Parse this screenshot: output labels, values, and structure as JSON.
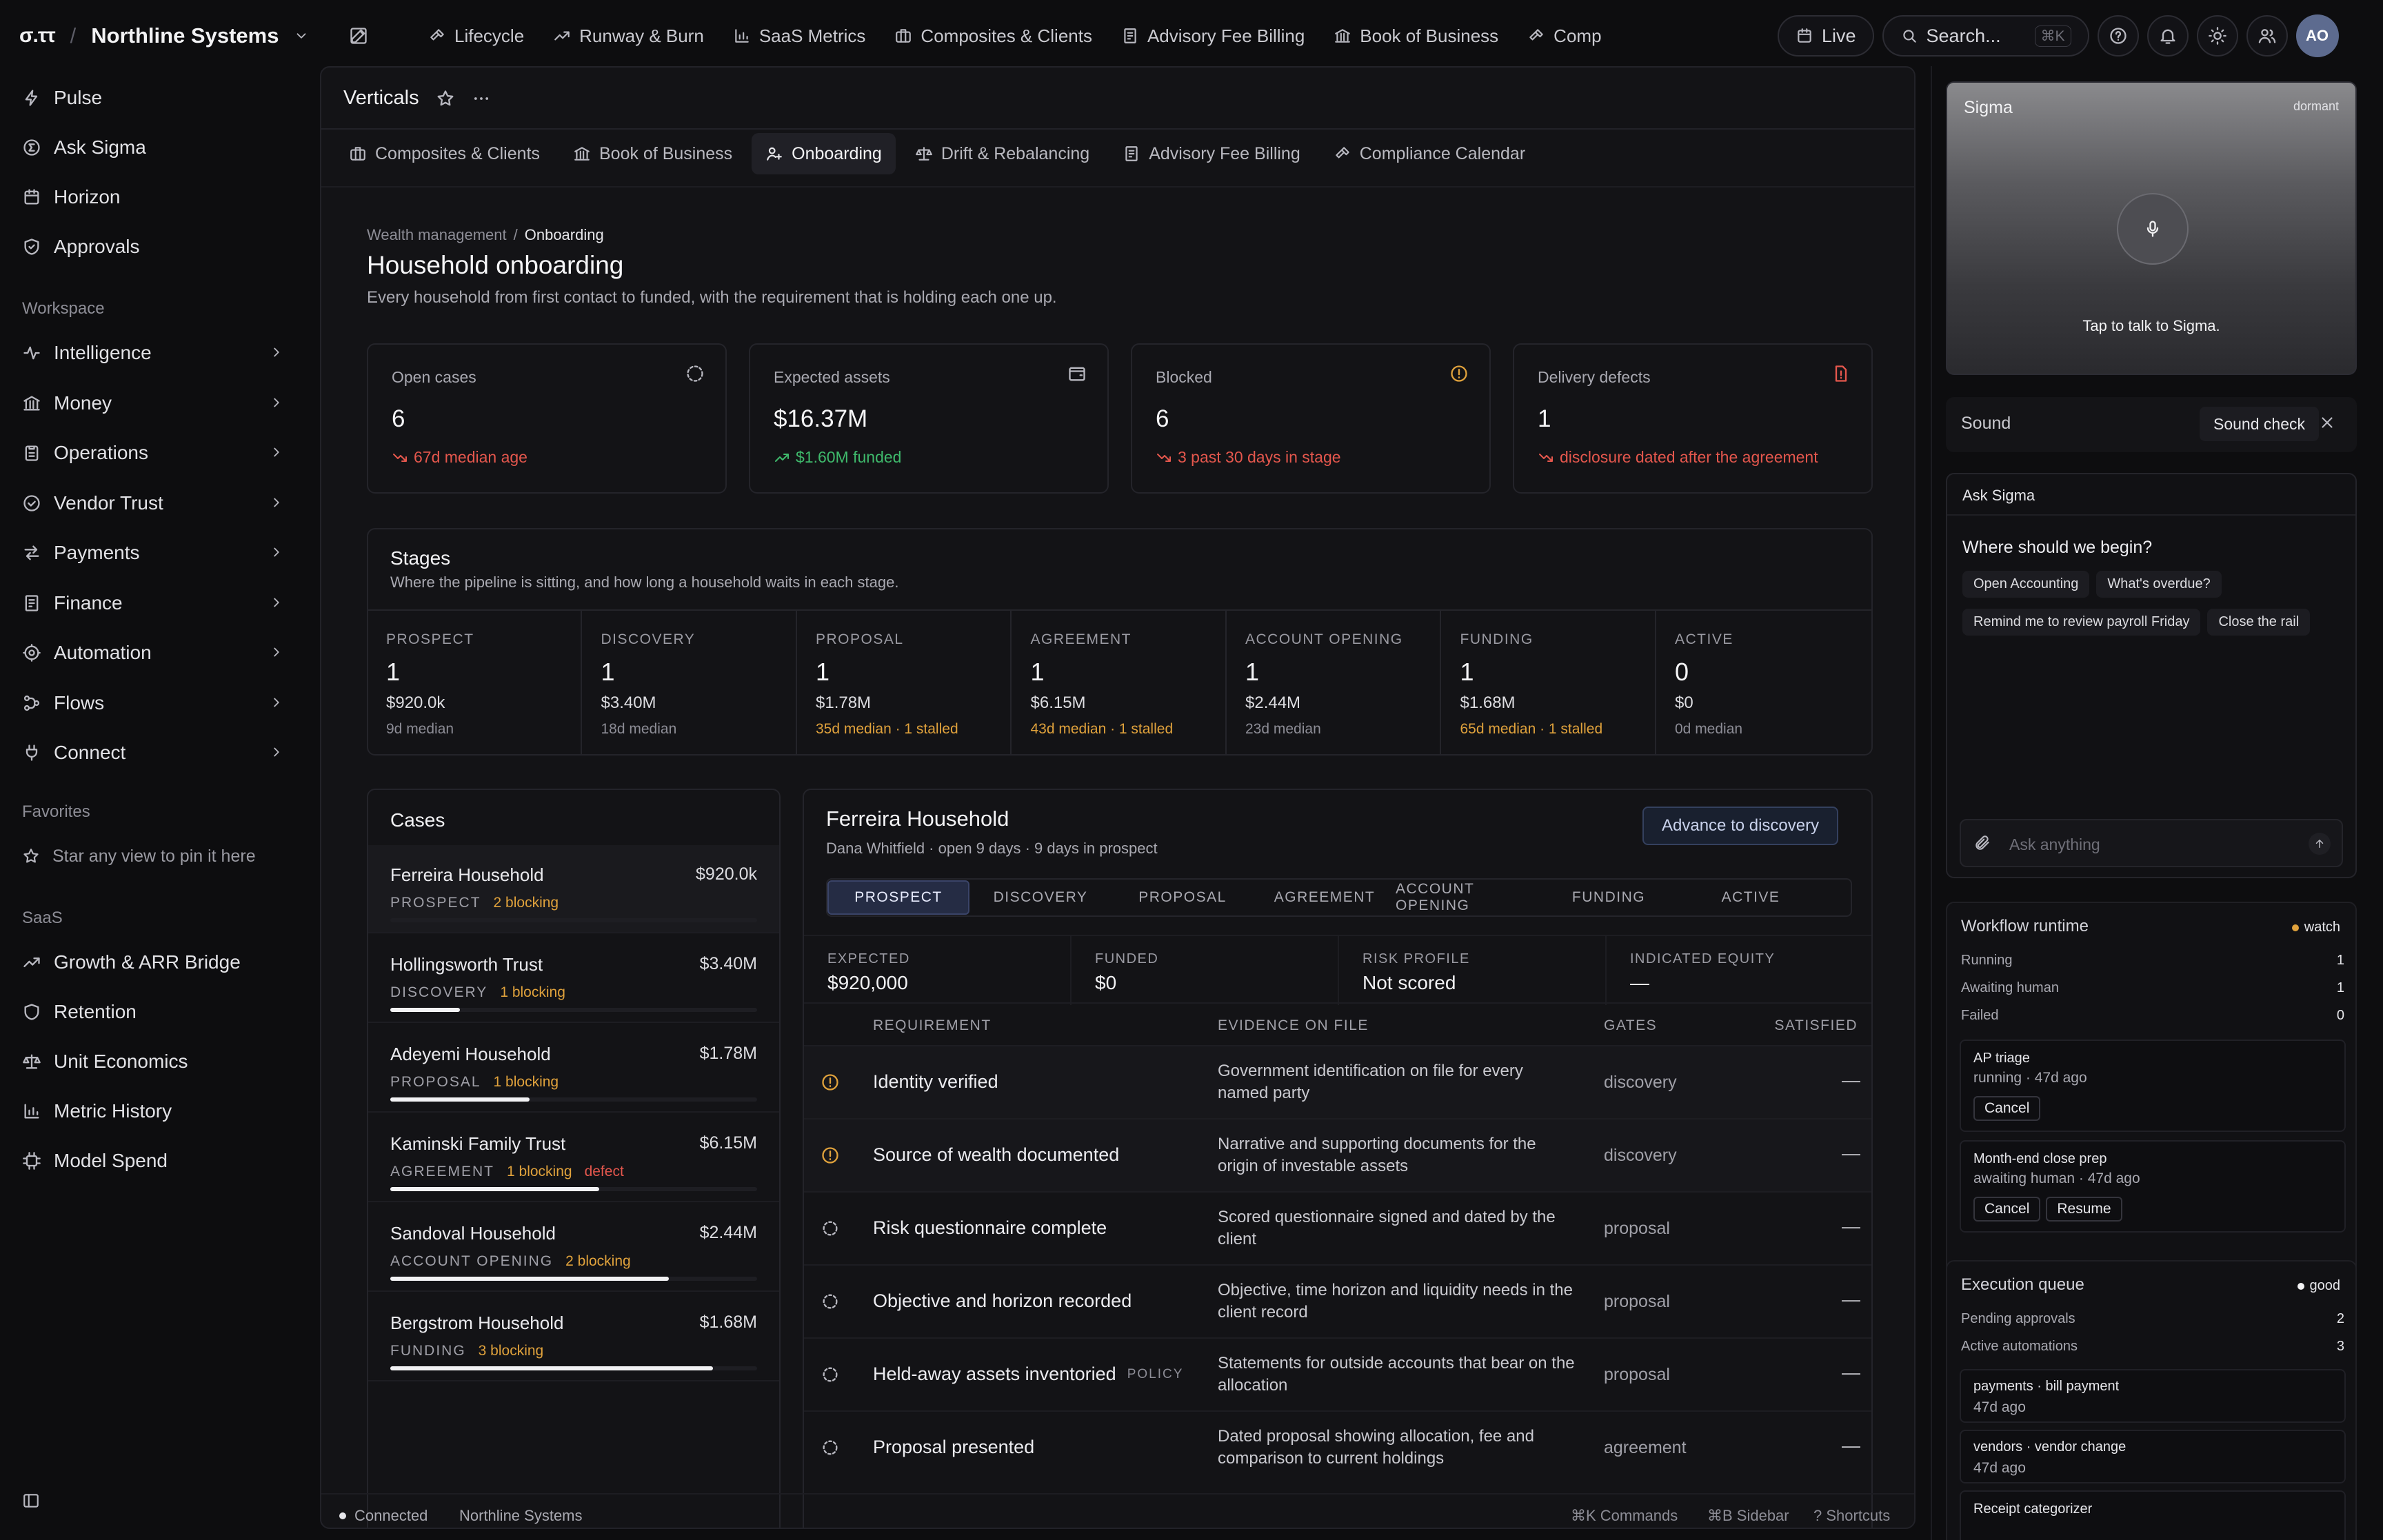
{
  "brand": {
    "logo": "σ.ττ",
    "org": "Northline Systems"
  },
  "topnav": [
    {
      "label": "Lifecycle",
      "icon": "hammer-icon"
    },
    {
      "label": "Runway & Burn",
      "icon": "trend-up-icon"
    },
    {
      "label": "SaaS Metrics",
      "icon": "bar-chart-icon"
    },
    {
      "label": "Composites & Clients",
      "icon": "briefcase-icon"
    },
    {
      "label": "Advisory Fee Billing",
      "icon": "receipt-icon"
    },
    {
      "label": "Book of Business",
      "icon": "bank-icon"
    },
    {
      "label": "Comp",
      "icon": "hammer-icon"
    }
  ],
  "topright": {
    "live": "Live",
    "search_placeholder": "Search...",
    "search_kbd": "⌘K",
    "avatar": "AO"
  },
  "sidebar": {
    "top": [
      {
        "label": "Pulse",
        "icon": "bolt-icon"
      },
      {
        "label": "Ask Sigma",
        "icon": "sigma-icon"
      },
      {
        "label": "Horizon",
        "icon": "calendar-icon"
      },
      {
        "label": "Approvals",
        "icon": "shield-check-icon"
      }
    ],
    "workspace_heading": "Workspace",
    "workspace": [
      {
        "label": "Intelligence",
        "icon": "pulse-icon"
      },
      {
        "label": "Money",
        "icon": "bank-icon"
      },
      {
        "label": "Operations",
        "icon": "clipboard-icon"
      },
      {
        "label": "Vendor Trust",
        "icon": "check-circle-icon"
      },
      {
        "label": "Payments",
        "icon": "arrows-icon"
      },
      {
        "label": "Finance",
        "icon": "receipt-icon"
      },
      {
        "label": "Automation",
        "icon": "robot-icon"
      },
      {
        "label": "Flows",
        "icon": "flow-icon"
      },
      {
        "label": "Connect",
        "icon": "plug-icon"
      }
    ],
    "favorites_heading": "Favorites",
    "favorites_empty": "Star any view to pin it here",
    "saas_heading": "SaaS",
    "saas": [
      {
        "label": "Growth & ARR Bridge",
        "icon": "trend-up-icon"
      },
      {
        "label": "Retention",
        "icon": "shield-icon"
      },
      {
        "label": "Unit Economics",
        "icon": "scale-icon"
      },
      {
        "label": "Metric History",
        "icon": "bar-chart-icon"
      },
      {
        "label": "Model Spend",
        "icon": "chip-icon"
      }
    ]
  },
  "main": {
    "title": "Verticals",
    "tabs": [
      {
        "label": "Composites & Clients",
        "icon": "briefcase-icon"
      },
      {
        "label": "Book of Business",
        "icon": "bank-icon"
      },
      {
        "label": "Onboarding",
        "icon": "user-plus-icon",
        "active": true
      },
      {
        "label": "Drift & Rebalancing",
        "icon": "scale-icon"
      },
      {
        "label": "Advisory Fee Billing",
        "icon": "receipt-icon"
      },
      {
        "label": "Compliance Calendar",
        "icon": "hammer-icon"
      }
    ],
    "breadcrumb": {
      "parent": "Wealth management",
      "sep": "/",
      "current": "Onboarding"
    },
    "page_title": "Household onboarding",
    "page_subtitle": "Every household from first contact to funded, with the requirement that is holding each one up.",
    "kpis": [
      {
        "label": "Open cases",
        "value": "6",
        "sub": "67d median age",
        "tone": "red",
        "icon": "dashed-circle-icon"
      },
      {
        "label": "Expected assets",
        "value": "$16.37M",
        "sub": "$1.60M funded",
        "tone": "green",
        "icon": "wallet-icon"
      },
      {
        "label": "Blocked",
        "value": "6",
        "sub": "3 past 30 days in stage",
        "tone": "red",
        "icon": "alert-circle-icon"
      },
      {
        "label": "Delivery defects",
        "value": "1",
        "sub": "disclosure dated after the agreement",
        "tone": "red",
        "icon": "file-alert-icon"
      }
    ],
    "stages_title": "Stages",
    "stages_subtitle": "Where the pipeline is sitting, and how long a household waits in each stage.",
    "stages": [
      {
        "label": "PROSPECT",
        "count": "1",
        "amount": "$920.0k",
        "median": "9d median",
        "warn": false
      },
      {
        "label": "DISCOVERY",
        "count": "1",
        "amount": "$3.40M",
        "median": "18d median",
        "warn": false
      },
      {
        "label": "PROPOSAL",
        "count": "1",
        "amount": "$1.78M",
        "median": "35d median · 1 stalled",
        "warn": true
      },
      {
        "label": "AGREEMENT",
        "count": "1",
        "amount": "$6.15M",
        "median": "43d median · 1 stalled",
        "warn": true
      },
      {
        "label": "ACCOUNT OPENING",
        "count": "1",
        "amount": "$2.44M",
        "median": "23d median",
        "warn": false
      },
      {
        "label": "FUNDING",
        "count": "1",
        "amount": "$1.68M",
        "median": "65d median · 1 stalled",
        "warn": true
      },
      {
        "label": "ACTIVE",
        "count": "0",
        "amount": "$0",
        "median": "0d median",
        "warn": false
      }
    ],
    "cases_title": "Cases",
    "cases": [
      {
        "name": "Ferreira Household",
        "amount": "$920.0k",
        "stage": "PROSPECT",
        "blocking": "2 blocking",
        "defect": "",
        "progress": 0,
        "selected": true
      },
      {
        "name": "Hollingsworth Trust",
        "amount": "$3.40M",
        "stage": "DISCOVERY",
        "blocking": "1 blocking",
        "defect": "",
        "progress": 0.19
      },
      {
        "name": "Adeyemi Household",
        "amount": "$1.78M",
        "stage": "PROPOSAL",
        "blocking": "1 blocking",
        "defect": "",
        "progress": 0.38
      },
      {
        "name": "Kaminski Family Trust",
        "amount": "$6.15M",
        "stage": "AGREEMENT",
        "blocking": "1 blocking",
        "defect": "defect",
        "progress": 0.57
      },
      {
        "name": "Sandoval Household",
        "amount": "$2.44M",
        "stage": "ACCOUNT OPENING",
        "blocking": "2 blocking",
        "defect": "",
        "progress": 0.76
      },
      {
        "name": "Bergstrom Household",
        "amount": "$1.68M",
        "stage": "FUNDING",
        "blocking": "3 blocking",
        "defect": "",
        "progress": 0.88
      }
    ],
    "detail": {
      "title": "Ferreira Household",
      "meta": "Dana Whitfield · open 9 days · 9 days in prospect",
      "advance_label": "Advance to discovery",
      "pipeline": [
        "PROSPECT",
        "DISCOVERY",
        "PROPOSAL",
        "AGREEMENT",
        "ACCOUNT OPENING",
        "FUNDING",
        "ACTIVE"
      ],
      "metrics": [
        {
          "label": "EXPECTED",
          "value": "$920,000"
        },
        {
          "label": "FUNDED",
          "value": "$0"
        },
        {
          "label": "RISK PROFILE",
          "value": "Not scored"
        },
        {
          "label": "INDICATED EQUITY",
          "value": "—"
        }
      ],
      "columns": [
        "REQUIREMENT",
        "EVIDENCE ON FILE",
        "GATES",
        "SATISFIED"
      ],
      "requirements": [
        {
          "name": "Identity verified",
          "evidence": "Government identification on file for every named party",
          "gate": "discovery",
          "satisfied": "—",
          "status": "alert",
          "policy": ""
        },
        {
          "name": "Source of wealth documented",
          "evidence": "Narrative and supporting documents for the origin of investable assets",
          "gate": "discovery",
          "satisfied": "—",
          "status": "alert",
          "policy": ""
        },
        {
          "name": "Risk questionnaire complete",
          "evidence": "Scored questionnaire signed and dated by the client",
          "gate": "proposal",
          "satisfied": "—",
          "status": "pending",
          "policy": ""
        },
        {
          "name": "Objective and horizon recorded",
          "evidence": "Objective, time horizon and liquidity needs in the client record",
          "gate": "proposal",
          "satisfied": "—",
          "status": "pending",
          "policy": ""
        },
        {
          "name": "Held-away assets inventoried",
          "evidence": "Statements for outside accounts that bear on the allocation",
          "gate": "proposal",
          "satisfied": "—",
          "status": "pending",
          "policy": "POLICY"
        },
        {
          "name": "Proposal presented",
          "evidence": "Dated proposal showing allocation, fee and comparison to current holdings",
          "gate": "agreement",
          "satisfied": "—",
          "status": "pending",
          "policy": ""
        }
      ]
    },
    "footer": {
      "status": "Connected",
      "org": "Northline Systems",
      "cmd": "⌘K Commands",
      "sidebar": "⌘B Sidebar",
      "shortcuts": "? Shortcuts"
    }
  },
  "right": {
    "sigma": {
      "title": "Sigma",
      "state": "dormant",
      "hint": "Tap to talk to Sigma."
    },
    "sound": {
      "label": "Sound",
      "check": "Sound check"
    },
    "ask": {
      "title": "Ask Sigma",
      "prompt": "Where should we begin?",
      "chips": [
        "Open Accounting",
        "What's overdue?",
        "Remind me to review payroll Friday",
        "Close the rail"
      ],
      "input_placeholder": "Ask anything"
    },
    "workflow": {
      "title": "Workflow runtime",
      "badge": "watch",
      "rows": [
        {
          "label": "Running",
          "value": "1"
        },
        {
          "label": "Awaiting human",
          "value": "1"
        },
        {
          "label": "Failed",
          "value": "0"
        }
      ],
      "jobs": [
        {
          "name": "AP triage",
          "status": "running · 47d ago",
          "buttons": [
            "Cancel"
          ]
        },
        {
          "name": "Month-end close prep",
          "status": "awaiting human · 47d ago",
          "buttons": [
            "Cancel",
            "Resume"
          ]
        }
      ]
    },
    "queue": {
      "title": "Execution queue",
      "badge": "good",
      "rows": [
        {
          "label": "Pending approvals",
          "value": "2"
        },
        {
          "label": "Active automations",
          "value": "3"
        }
      ],
      "items": [
        {
          "name": "payments · bill payment",
          "time": "47d ago"
        },
        {
          "name": "vendors · vendor change",
          "time": "47d ago"
        },
        {
          "name": "Receipt categorizer",
          "time": ""
        }
      ]
    }
  }
}
